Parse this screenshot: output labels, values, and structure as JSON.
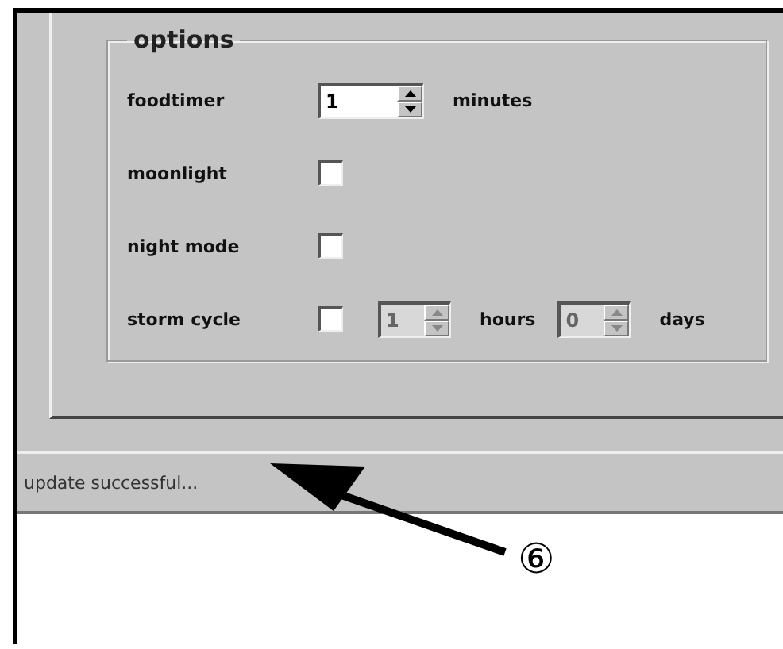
{
  "options": {
    "title": "options",
    "rows": [
      {
        "kind": "spinner",
        "label": "foodtimer",
        "spinners": [
          {
            "value": "1",
            "unit": "minutes",
            "disabled": false
          }
        ]
      },
      {
        "kind": "checkbox",
        "label": "moonlight",
        "checked": false
      },
      {
        "kind": "checkbox",
        "label": "night mode",
        "checked": false
      },
      {
        "kind": "checkbox",
        "label": "storm cycle",
        "checked": false,
        "spinners": [
          {
            "value": "1",
            "unit": "hours",
            "disabled": true
          },
          {
            "value": "0",
            "unit": "days",
            "disabled": true
          }
        ]
      }
    ]
  },
  "status_bar": {
    "text": "update successful..."
  },
  "callout": {
    "number": "⑥"
  }
}
